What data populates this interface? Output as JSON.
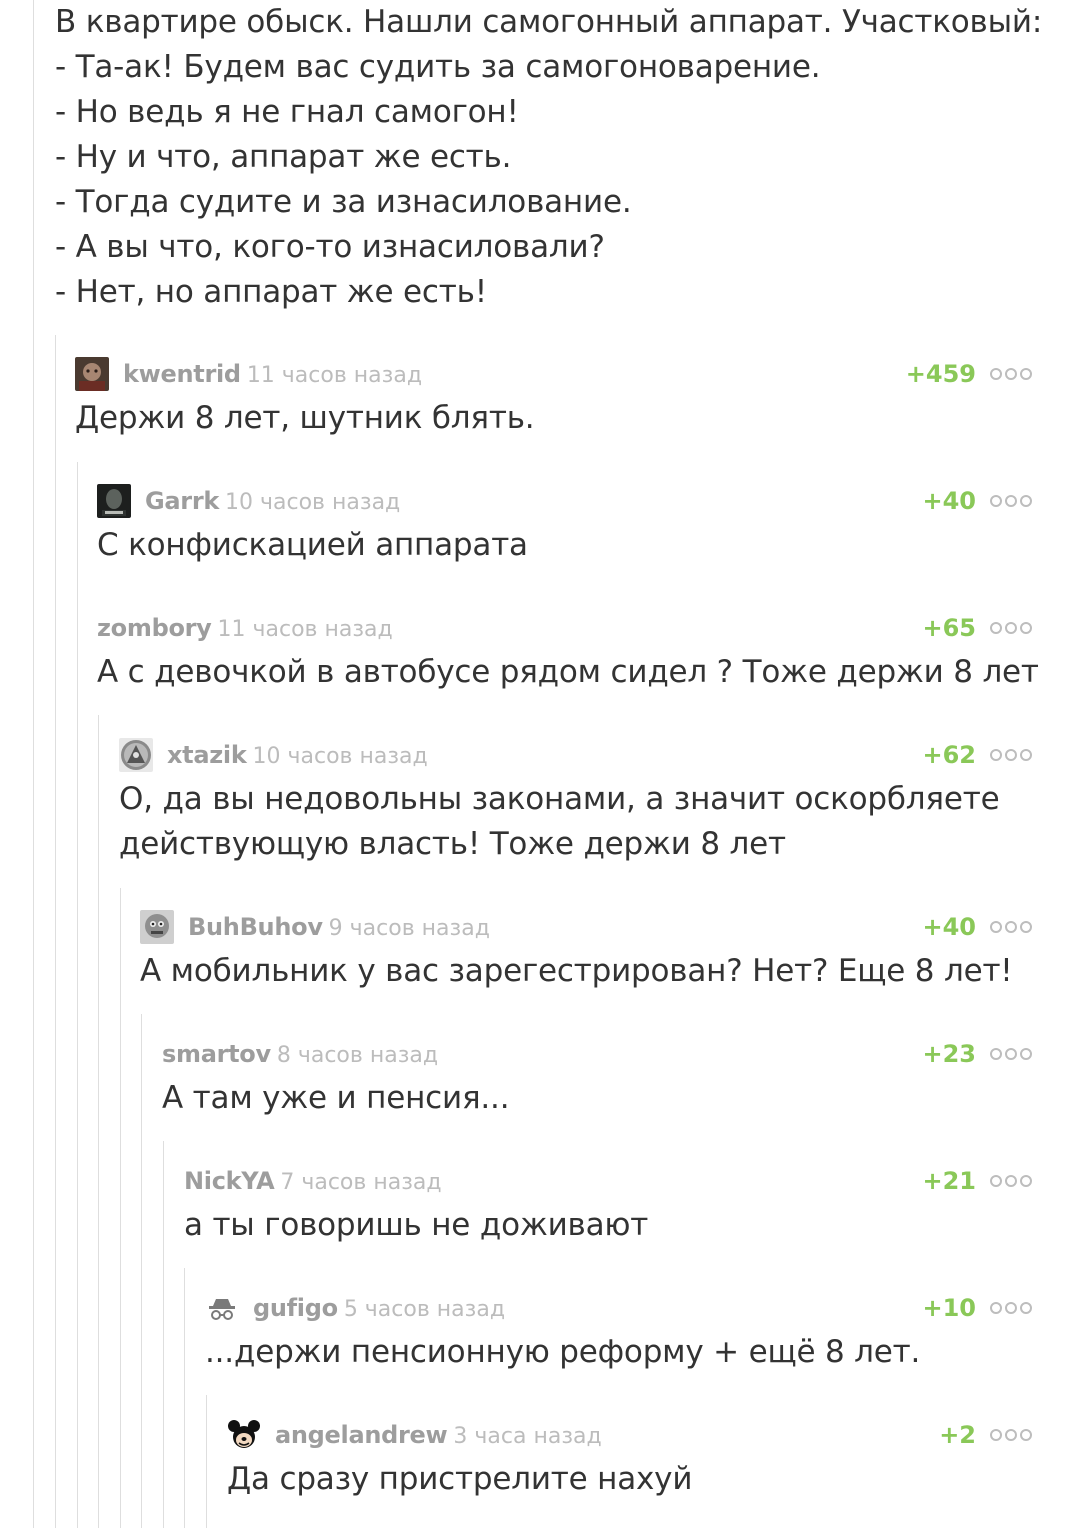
{
  "post": {
    "lines": [
      "В квартире обыск. Нашли самогонный аппарат. Участковый:",
      "- Та-ак! Будем вас судить за самогоноварение.",
      "- Но ведь я не гнал самогон!",
      "- Ну и что, аппарат же есть.",
      "- Тогда судите и за изнасилование.",
      "- А вы что, кого-то изнасиловали?",
      "- Нет, но аппарат же есть!"
    ]
  },
  "comments": [
    {
      "user": "kwentrid",
      "time": "11 часов назад",
      "rating": "+459",
      "text": "Держи 8 лет, шутник блять.",
      "avatar": "avatar-photo"
    },
    {
      "user": "Garrk",
      "time": "10 часов назад",
      "rating": "+40",
      "text": "С конфискацией аппарата",
      "avatar": "avatar-photo"
    },
    {
      "user": "zombory",
      "time": "11 часов назад",
      "rating": "+65",
      "text": "А с девочкой в автобусе рядом сидел ? Тоже держи 8 лет",
      "avatar": ""
    },
    {
      "user": "xtazik",
      "time": "10 часов назад",
      "rating": "+62",
      "text": [
        "О, да вы недовольны законами, а значит оскорбляете",
        "действующую власть! Тоже держи 8 лет"
      ],
      "avatar": "avatar-photo"
    },
    {
      "user": "BuhBuhov",
      "time": "9 часов назад",
      "rating": "+40",
      "text": "А мобильник у вас зарегестрирован? Нет? Еще 8 лет!",
      "avatar": "avatar-photo"
    },
    {
      "user": "smartov",
      "time": "8 часов назад",
      "rating": "+23",
      "text": "А там уже и пенсия...",
      "avatar": ""
    },
    {
      "user": "NickYA",
      "time": "7 часов назад",
      "rating": "+21",
      "text": "а ты говоришь не доживают",
      "avatar": ""
    },
    {
      "user": "gufigo",
      "time": "5 часов назад",
      "rating": "+10",
      "text": "...держи пенсионную реформу + ещё 8 лет.",
      "avatar": "incognito-icon"
    },
    {
      "user": "angelandrew",
      "time": "3 часа назад",
      "rating": "+2",
      "text": "Да сразу пристрелите нахуй",
      "avatar": "mickey-icon"
    }
  ],
  "colors": {
    "rating": "#8ac858",
    "username": "#9d9d9d",
    "time": "#bcbcbc",
    "text": "#333333",
    "thread_line": "#dedede"
  }
}
